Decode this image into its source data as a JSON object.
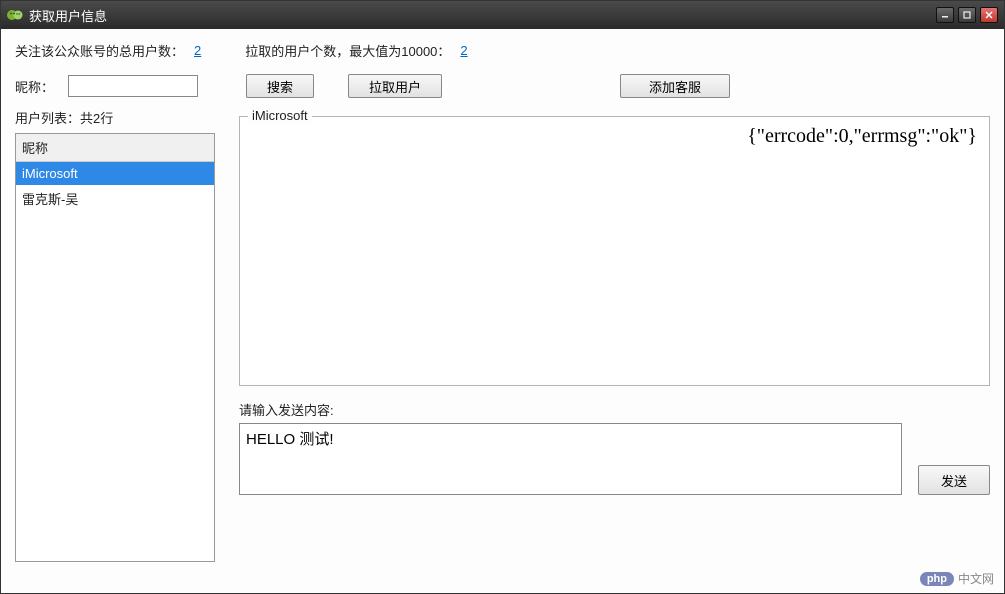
{
  "window": {
    "title": "获取用户信息"
  },
  "info": {
    "total_label": "关注该公众账号的总用户数：",
    "total_value": "2",
    "pulled_label": "拉取的用户个数，最大值为10000：",
    "pulled_value": "2"
  },
  "search": {
    "nick_label": "昵称：",
    "nick_value": "",
    "search_btn": "搜索",
    "pull_btn": "拉取用户",
    "add_btn": "添加客服"
  },
  "userlist": {
    "title": "用户列表：共2行",
    "header": "昵称",
    "rows": [
      {
        "name": "iMicrosoft",
        "selected": true
      },
      {
        "name": "雷克斯-吴",
        "selected": false
      }
    ]
  },
  "response": {
    "group_label": "iMicrosoft",
    "body": "{\"errcode\":0,\"errmsg\":\"ok\"}"
  },
  "send": {
    "label": "请输入发送内容:",
    "value": "HELLO 测试!",
    "btn": "发送"
  },
  "footer": {
    "badge": "php",
    "text": "中文网"
  }
}
